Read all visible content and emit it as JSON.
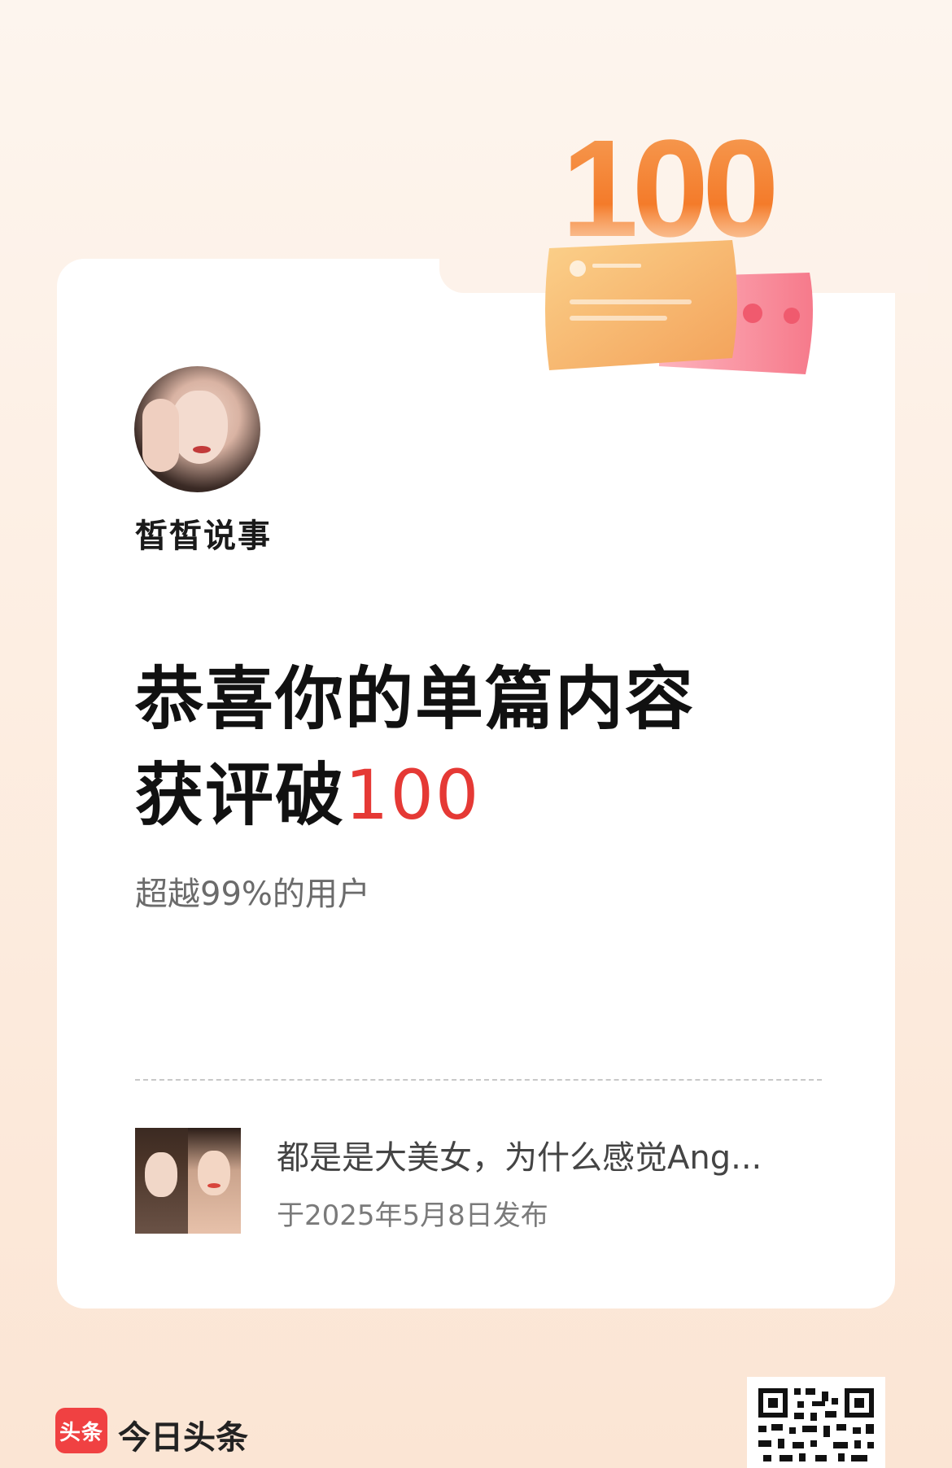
{
  "badge": {
    "number": "100"
  },
  "author": {
    "name": "皙皙说事"
  },
  "headline": {
    "line1": "恭喜你的单篇内容",
    "line2_prefix": "获评破",
    "line2_number": "100"
  },
  "subtext": "超越99%的用户",
  "article": {
    "title": "都是是大美女，为什么感觉Ang...",
    "date": "于2025年5月8日发布"
  },
  "footer": {
    "logo_mark": "头条",
    "logo_text": "今日头条"
  },
  "colors": {
    "accent_red": "#e53935",
    "badge_orange": "#f5822e",
    "brand_red": "#f04142"
  }
}
